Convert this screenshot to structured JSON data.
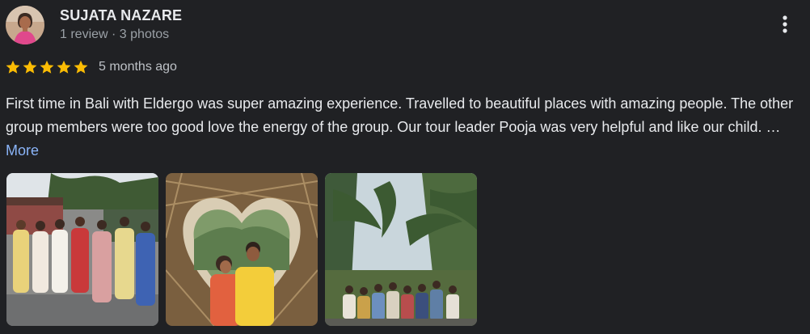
{
  "reviewer": {
    "name": "SUJATA NAZARE",
    "meta": "1 review · 3 photos",
    "avatar_icon": "person-avatar"
  },
  "rating": {
    "stars": 5,
    "max_stars": 5,
    "star_color": "#fbbc04",
    "time": "5 months ago"
  },
  "review": {
    "text": "First time in Bali with Eldergo was super amazing experience. Travelled to beautiful places with amazing people. The other group members were too good love the energy of the group. Our tour leader Pooja was very helpful and like our child. …",
    "more_label": "More"
  },
  "menu": {
    "icon": "more-vert-icon"
  },
  "photos": [
    {
      "id": "group-photo-women"
    },
    {
      "id": "couple-heart-frame-photo"
    },
    {
      "id": "group-jungle-photo"
    }
  ],
  "colors": {
    "background": "#202124",
    "link": "#8ab4f8",
    "star": "#fbbc04"
  }
}
